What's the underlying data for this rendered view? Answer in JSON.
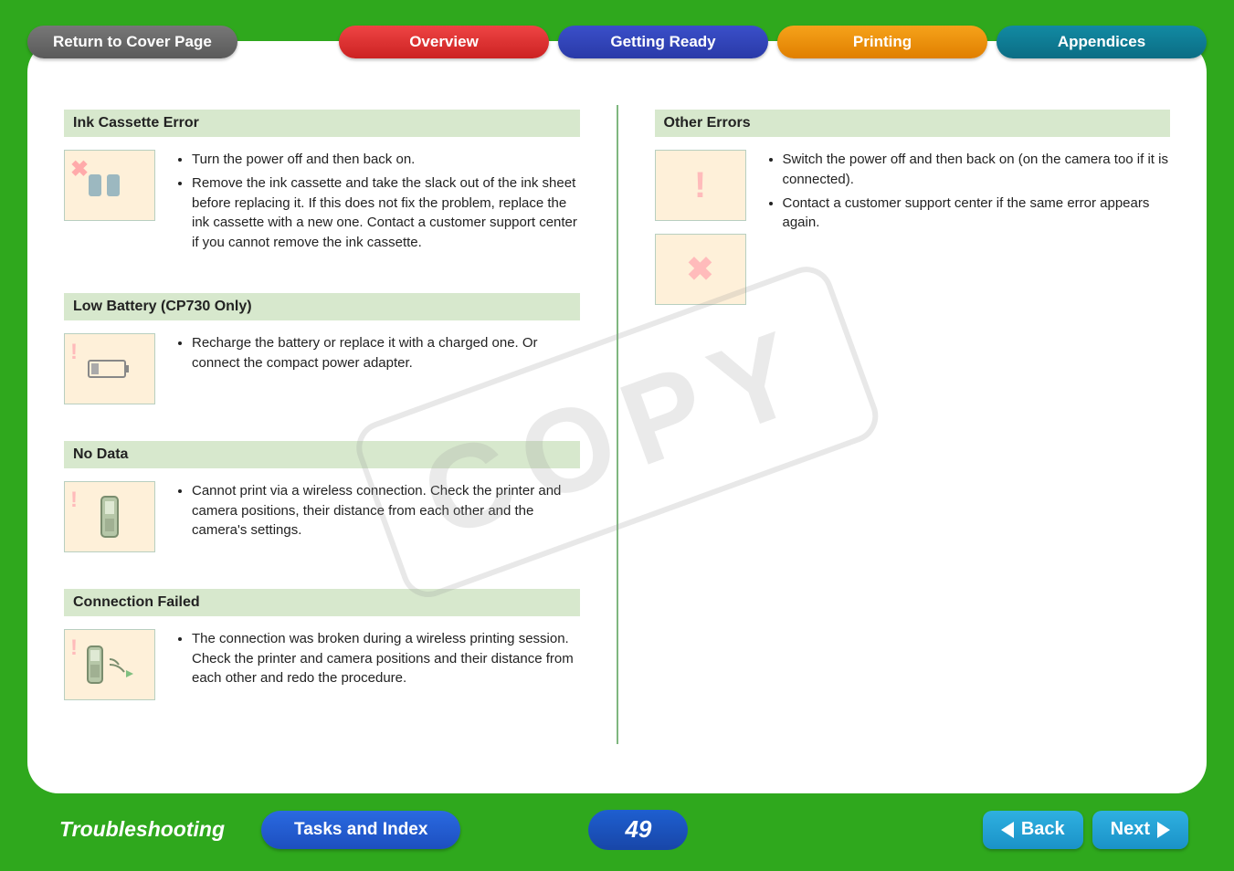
{
  "nav": {
    "return": "Return to Cover Page",
    "overview": "Overview",
    "getting_ready": "Getting Ready",
    "printing": "Printing",
    "appendices": "Appendices"
  },
  "left": {
    "s1": {
      "title": "Ink Cassette Error",
      "b1": "Turn the power off and then back on.",
      "b2": "Remove the ink cassette and take the slack out of the ink sheet before replacing it. If this does not fix the problem, replace the ink cassette with a new one. Contact a customer support center if you cannot remove the ink cassette."
    },
    "s2": {
      "title": "Low Battery (CP730 Only)",
      "b1": "Recharge the battery or replace it with a charged one. Or connect the compact power adapter."
    },
    "s3": {
      "title": "No Data",
      "b1": "Cannot print via a wireless connection. Check the printer and camera positions, their distance from each other and the camera's settings."
    },
    "s4": {
      "title": "Connection Failed",
      "b1": "The connection was broken during a wireless printing session. Check the printer and camera positions and their distance from each other and redo the procedure."
    }
  },
  "right": {
    "s1": {
      "title": "Other Errors",
      "b1": "Switch the power off and then back on (on the camera too if it is connected).",
      "b2": "Contact a customer support center if the same error appears again."
    }
  },
  "watermark": "COPY",
  "footer": {
    "section": "Troubleshooting",
    "tasks": "Tasks and Index",
    "page": "49",
    "back": "Back",
    "next": "Next"
  }
}
